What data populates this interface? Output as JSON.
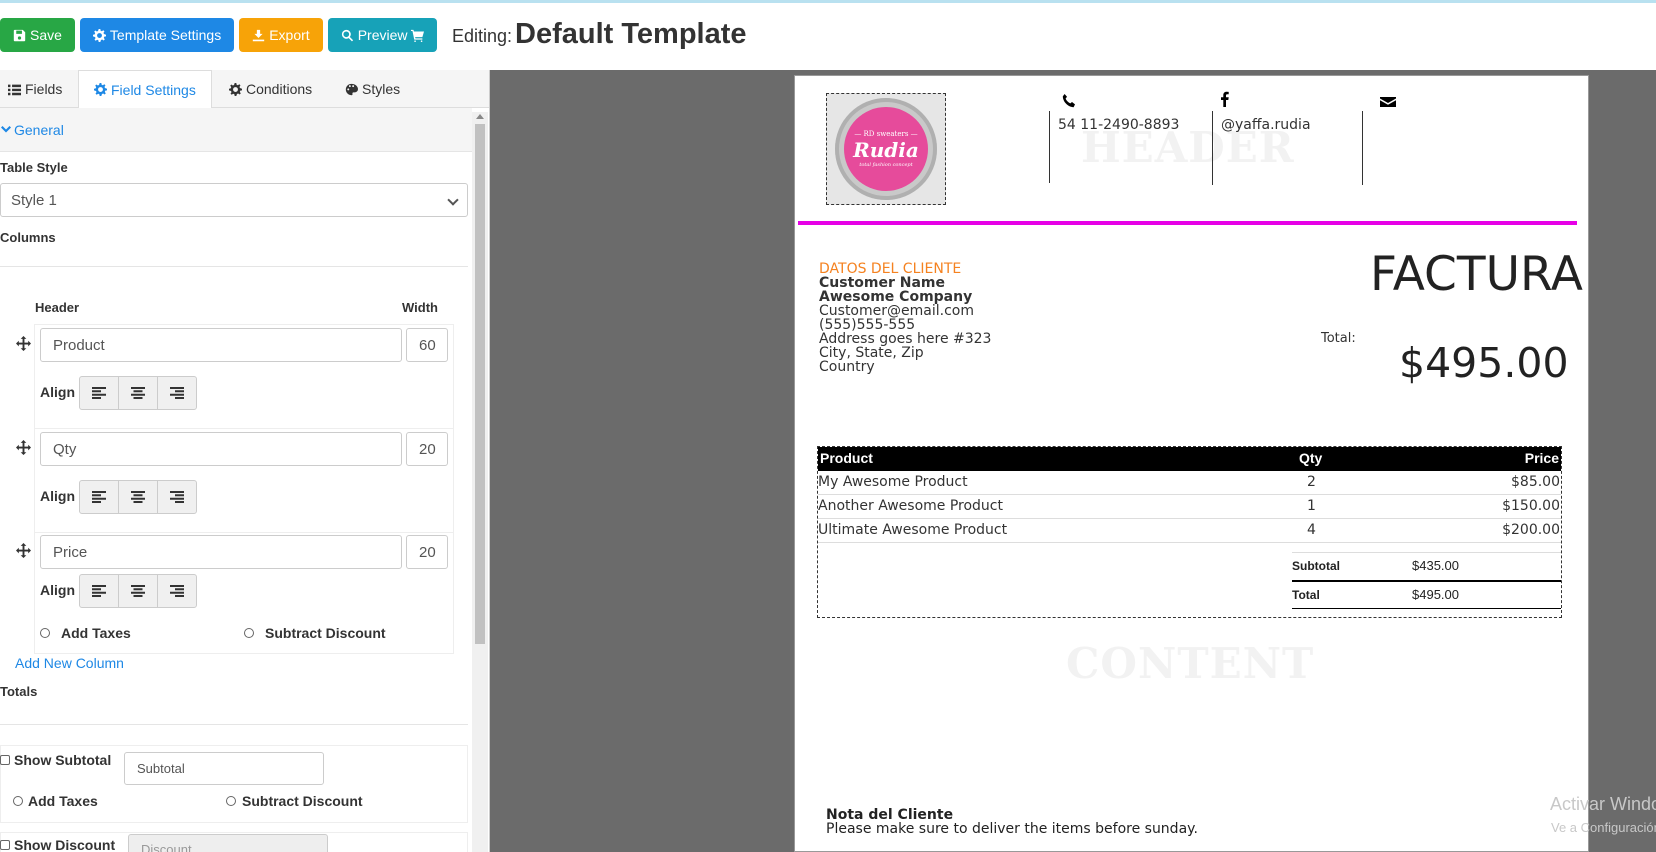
{
  "toolbar": {
    "save_label": "Save",
    "template_settings_label": "Template Settings",
    "export_label": "Export",
    "preview_label": "Preview",
    "editing_label": "Editing:",
    "editing_title": "Default Template"
  },
  "tabs": [
    {
      "label": "Fields",
      "icon": "list-icon"
    },
    {
      "label": "Field Settings",
      "icon": "gear-icon",
      "active": true
    },
    {
      "label": "Conditions",
      "icon": "gear-icon"
    },
    {
      "label": "Styles",
      "icon": "palette-icon"
    }
  ],
  "panel": {
    "section_title": "General",
    "table_style_label": "Table Style",
    "table_style_value": "Style 1",
    "columns_label": "Columns",
    "header_col_label": "Header",
    "width_col_label": "Width",
    "align_label": "Align",
    "columns": [
      {
        "header": "Product",
        "width": "60"
      },
      {
        "header": "Qty",
        "width": "20"
      },
      {
        "header": "Price",
        "width": "20"
      }
    ],
    "add_taxes_label": "Add Taxes",
    "subtract_discount_label": "Subtract Discount",
    "add_new_column_label": "Add New Column",
    "totals_label": "Totals",
    "show_subtotal_label": "Show Subtotal",
    "subtotal_input_value": "Subtotal",
    "show_discount_label": "Show Discount",
    "discount_input_placeholder": "Discount"
  },
  "invoice": {
    "header_watermark": "HEADER",
    "content_watermark": "CONTENT",
    "logo": {
      "top": "— RD sweaters —",
      "name": "Rudia",
      "tagline": "total fashion concept"
    },
    "phone": "54 11-2490-8893",
    "facebook": "@yaffa.rudia",
    "client": {
      "heading": "DATOS DEL CLIENTE",
      "name": "Customer Name",
      "company": "Awesome Company",
      "email": "Customer@email.com",
      "phone": "(555)555-555",
      "address": "Address goes here #323",
      "city": "City, State, Zip",
      "country": "Country"
    },
    "doc_title": "FACTURA",
    "total_label": "Total:",
    "total_amount": "$495.00",
    "table_headers": {
      "product": "Product",
      "qty": "Qty",
      "price": "Price"
    },
    "rows": [
      {
        "product": "My Awesome Product",
        "qty": "2",
        "price": "$85.00"
      },
      {
        "product": "Another Awesome Product",
        "qty": "1",
        "price": "$150.00"
      },
      {
        "product": "Ultimate Awesome Product",
        "qty": "4",
        "price": "$200.00"
      }
    ],
    "subtotal_label": "Subtotal",
    "subtotal_value": "$435.00",
    "grand_total_label": "Total",
    "grand_total_value": "$495.00",
    "note_title": "Nota del Cliente",
    "note_text": "Please make sure to deliver the items before sunday."
  },
  "os_watermark": {
    "line1": "Activar Windows",
    "line2": "Ve a Configuración"
  },
  "colors": {
    "save": "#28a745",
    "settings": "#1e88e5",
    "export": "#f7a308",
    "preview": "#17a2b8",
    "accent_bar": "#e600e6",
    "client_heading": "#f58220"
  }
}
